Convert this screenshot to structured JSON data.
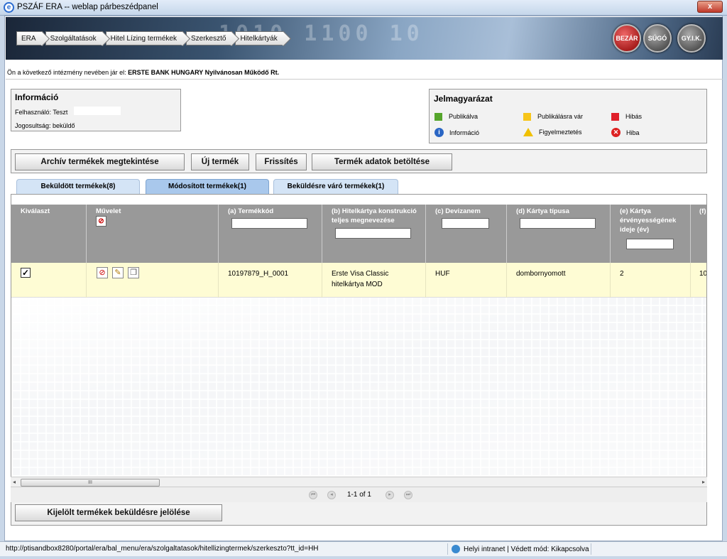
{
  "window": {
    "title": "PSZÁF ERA -- weblap párbeszédpanel",
    "close_label": "x"
  },
  "banner": {
    "digits": "1010 1100 10"
  },
  "breadcrumb": [
    "ERA",
    "Szolgáltatások",
    "Hitel Lízing termékek",
    "Szerkesztő",
    "Hitelkártyák"
  ],
  "header_buttons": {
    "close": "BEZÁR",
    "help": "SÚGÓ",
    "faq": "GY.I.K."
  },
  "institution": {
    "prefix": "Ön a következő intézmény nevében jár el:",
    "name": "ERSTE BANK HUNGARY Nyilvánosan Működő Rt."
  },
  "info": {
    "title": "Információ",
    "user": "Felhasználó: Teszt",
    "role": "Jogosultság: beküldő"
  },
  "legend": {
    "title": "Jelmagyarázat",
    "items": [
      {
        "label": "Publikálva",
        "color": "#55a52b"
      },
      {
        "label": "Publikálásra vár",
        "color": "#f7c51a"
      },
      {
        "label": "Hibás",
        "color": "#e0202a"
      },
      {
        "label": "Információ",
        "icon": "info-icon"
      },
      {
        "label": "Figyelmeztetés",
        "icon": "warning-icon"
      },
      {
        "label": "Hiba",
        "icon": "error-icon"
      }
    ]
  },
  "toolbar": {
    "archive": "Archív termékek megtekintése",
    "new": "Új termék",
    "refresh": "Frissítés",
    "load": "Termék adatok betöltése"
  },
  "tabs": [
    {
      "label": "Beküldött termékek(8)",
      "active": false
    },
    {
      "label": "Módosított termékek(1)",
      "active": true
    },
    {
      "label": "Beküldésre váró termékek(1)",
      "active": false
    }
  ],
  "columns": [
    "Kiválaszt",
    "Művelet",
    "(a) Termékkód",
    "(b) Hitelkártya konstrukció teljes megnevezése",
    "(c) Devizanem",
    "(d) Kártya típusa",
    "(e) Kártya érvényességének ideje (év)",
    "(f) hitel mi"
  ],
  "row": {
    "checked": true,
    "code": "10197879_H_0001",
    "name": "Erste Visa Classic hitelkártya MOD",
    "currency": "HUF",
    "card_type": "dombornyomott",
    "validity": "2",
    "next": "10"
  },
  "scroll_thumb": "III",
  "pager": {
    "text": "1-1 of 1"
  },
  "bottom_button": "Kijelölt termékek beküldésre jelölése",
  "status": {
    "url": "http://ptisandbox8280/portal/era/bal_menu/era/szolgaltatasok/hitellizingtermek/szerkeszto?tt_id=HH",
    "zone": "Helyi intranet | Védett mód: Kikapcsolva"
  }
}
